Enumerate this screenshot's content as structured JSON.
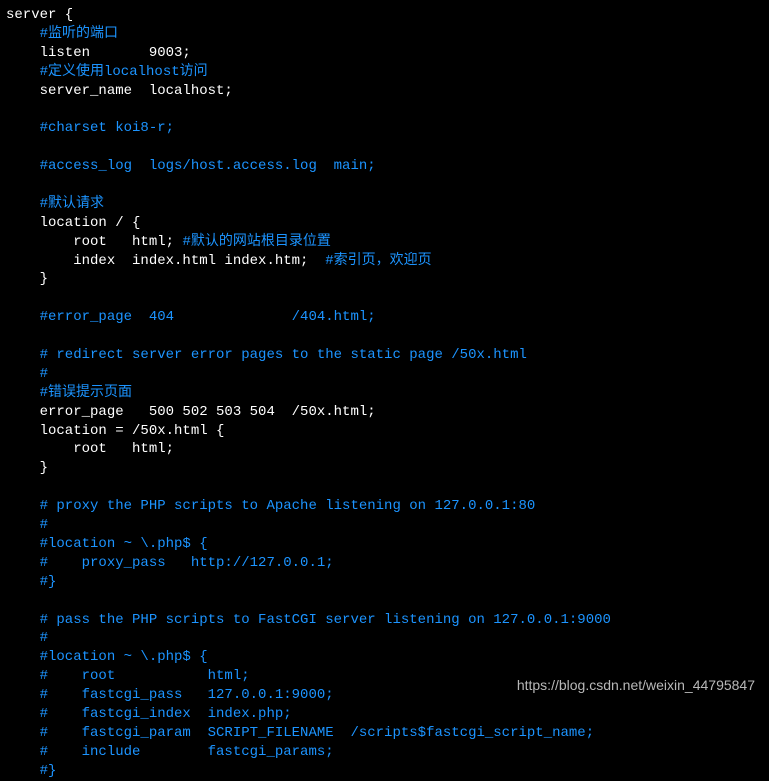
{
  "lines": [
    {
      "segs": [
        {
          "cls": "w",
          "txt": "server {"
        }
      ]
    },
    {
      "segs": [
        {
          "cls": "b",
          "txt": "    #监听的端口"
        }
      ]
    },
    {
      "segs": [
        {
          "cls": "w",
          "txt": "    listen       9003;"
        }
      ]
    },
    {
      "segs": [
        {
          "cls": "b",
          "txt": "    #定义使用localhost访问"
        }
      ]
    },
    {
      "segs": [
        {
          "cls": "w",
          "txt": "    server_name  localhost;"
        }
      ]
    },
    {
      "segs": [
        {
          "cls": "w",
          "txt": ""
        }
      ]
    },
    {
      "segs": [
        {
          "cls": "b",
          "txt": "    #charset koi8-r;"
        }
      ]
    },
    {
      "segs": [
        {
          "cls": "w",
          "txt": ""
        }
      ]
    },
    {
      "segs": [
        {
          "cls": "b",
          "txt": "    #access_log  logs/host.access.log  main;"
        }
      ]
    },
    {
      "segs": [
        {
          "cls": "w",
          "txt": ""
        }
      ]
    },
    {
      "segs": [
        {
          "cls": "b",
          "txt": "    #默认请求"
        }
      ]
    },
    {
      "segs": [
        {
          "cls": "w",
          "txt": "    location / {"
        }
      ]
    },
    {
      "segs": [
        {
          "cls": "w",
          "txt": "        root   html; "
        },
        {
          "cls": "b",
          "txt": "#默认的网站根目录位置"
        }
      ]
    },
    {
      "segs": [
        {
          "cls": "w",
          "txt": "        index  index.html index.htm;  "
        },
        {
          "cls": "b",
          "txt": "#索引页，欢迎页"
        }
      ]
    },
    {
      "segs": [
        {
          "cls": "w",
          "txt": "    }"
        }
      ]
    },
    {
      "segs": [
        {
          "cls": "w",
          "txt": ""
        }
      ]
    },
    {
      "segs": [
        {
          "cls": "b",
          "txt": "    #error_page  404              /404.html;"
        }
      ]
    },
    {
      "segs": [
        {
          "cls": "w",
          "txt": ""
        }
      ]
    },
    {
      "segs": [
        {
          "cls": "b",
          "txt": "    # redirect server error pages to the static page /50x.html"
        }
      ]
    },
    {
      "segs": [
        {
          "cls": "b",
          "txt": "    #"
        }
      ]
    },
    {
      "segs": [
        {
          "cls": "b",
          "txt": "    #错误提示页面"
        }
      ]
    },
    {
      "segs": [
        {
          "cls": "w",
          "txt": "    error_page   500 502 503 504  /50x.html;"
        }
      ]
    },
    {
      "segs": [
        {
          "cls": "w",
          "txt": "    location = /50x.html {"
        }
      ]
    },
    {
      "segs": [
        {
          "cls": "w",
          "txt": "        root   html;"
        }
      ]
    },
    {
      "segs": [
        {
          "cls": "w",
          "txt": "    }"
        }
      ]
    },
    {
      "segs": [
        {
          "cls": "w",
          "txt": ""
        }
      ]
    },
    {
      "segs": [
        {
          "cls": "b",
          "txt": "    # proxy the PHP scripts to Apache listening on 127.0.0.1:80"
        }
      ]
    },
    {
      "segs": [
        {
          "cls": "b",
          "txt": "    #"
        }
      ]
    },
    {
      "segs": [
        {
          "cls": "b",
          "txt": "    #location ~ \\.php$ {"
        }
      ]
    },
    {
      "segs": [
        {
          "cls": "b",
          "txt": "    #    proxy_pass   http://127.0.0.1;"
        }
      ]
    },
    {
      "segs": [
        {
          "cls": "b",
          "txt": "    #}"
        }
      ]
    },
    {
      "segs": [
        {
          "cls": "w",
          "txt": ""
        }
      ]
    },
    {
      "segs": [
        {
          "cls": "b",
          "txt": "    # pass the PHP scripts to FastCGI server listening on 127.0.0.1:9000"
        }
      ]
    },
    {
      "segs": [
        {
          "cls": "b",
          "txt": "    #"
        }
      ]
    },
    {
      "segs": [
        {
          "cls": "b",
          "txt": "    #location ~ \\.php$ {"
        }
      ]
    },
    {
      "segs": [
        {
          "cls": "b",
          "txt": "    #    root           html;"
        }
      ]
    },
    {
      "segs": [
        {
          "cls": "b",
          "txt": "    #    fastcgi_pass   127.0.0.1:9000;"
        }
      ]
    },
    {
      "segs": [
        {
          "cls": "b",
          "txt": "    #    fastcgi_index  index.php;"
        }
      ]
    },
    {
      "segs": [
        {
          "cls": "b",
          "txt": "    #    fastcgi_param  SCRIPT_FILENAME  /scripts$fastcgi_script_name;"
        }
      ]
    },
    {
      "segs": [
        {
          "cls": "b",
          "txt": "    #    include        fastcgi_params;"
        }
      ]
    },
    {
      "segs": [
        {
          "cls": "b",
          "txt": "    #}"
        }
      ]
    }
  ],
  "watermark": "https://blog.csdn.net/weixin_44795847"
}
